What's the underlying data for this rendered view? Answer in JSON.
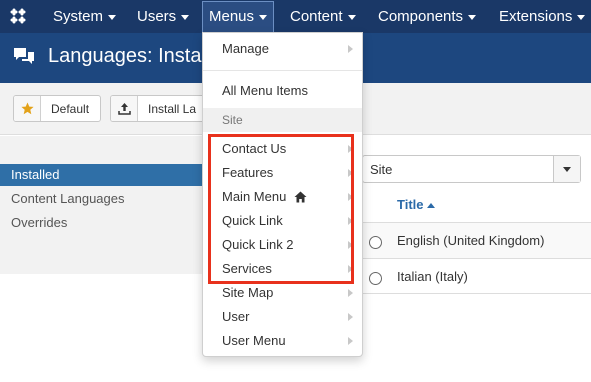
{
  "navbar": {
    "items": [
      {
        "label": "System"
      },
      {
        "label": "Users"
      },
      {
        "label": "Menus"
      },
      {
        "label": "Content"
      },
      {
        "label": "Components"
      },
      {
        "label": "Extensions"
      }
    ]
  },
  "header": {
    "title": "Languages: Insta",
    "icon": "speech-bubbles-icon"
  },
  "toolbar": {
    "default_label": "Default",
    "install_label": "Install La"
  },
  "sidebar": {
    "items": [
      {
        "label": "Installed",
        "active": true
      },
      {
        "label": "Content Languages"
      },
      {
        "label": "Overrides"
      }
    ]
  },
  "filter": {
    "selected": "Site"
  },
  "table": {
    "column_title": "Title",
    "rows": [
      {
        "title": "English (United Kingdom)"
      },
      {
        "title": "Italian (Italy)"
      }
    ]
  },
  "menus_dropdown": {
    "manage": "Manage",
    "all_items": "All Menu Items",
    "section_header": "Site",
    "menus": [
      {
        "label": "Contact Us"
      },
      {
        "label": "Features"
      },
      {
        "label": "Main Menu"
      },
      {
        "label": "Quick Link"
      },
      {
        "label": "Quick Link 2"
      },
      {
        "label": "Services"
      },
      {
        "label": "Site Map"
      },
      {
        "label": "User"
      },
      {
        "label": "User Menu"
      }
    ],
    "home_icon": "home-icon"
  },
  "colors": {
    "navbar": "#1a3867",
    "titlebar": "#1d477f",
    "active_sidebar": "#2f6fa7",
    "highlight": "#e8311c",
    "link": "#2b6aa8"
  }
}
